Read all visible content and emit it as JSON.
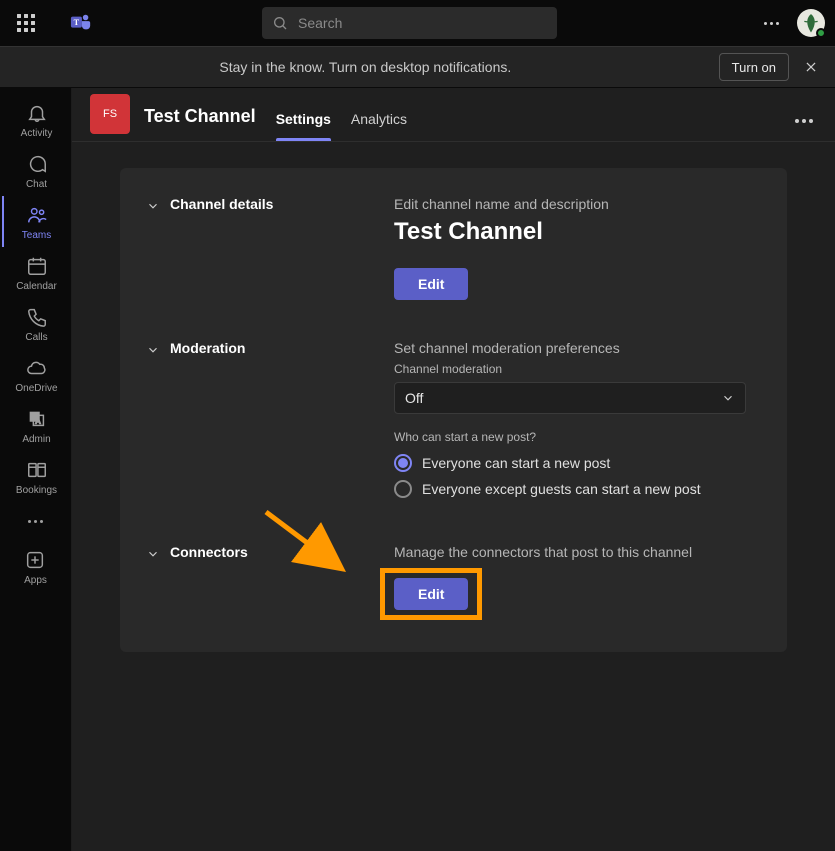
{
  "titlebar": {
    "search_placeholder": "Search"
  },
  "notif": {
    "text": "Stay in the know. Turn on desktop notifications.",
    "turn_on": "Turn on"
  },
  "rail": {
    "activity": "Activity",
    "chat": "Chat",
    "teams": "Teams",
    "calendar": "Calendar",
    "calls": "Calls",
    "onedrive": "OneDrive",
    "admin": "Admin",
    "bookings": "Bookings",
    "apps": "Apps"
  },
  "channel": {
    "badge": "FS",
    "name": "Test Channel",
    "tabs": {
      "settings": "Settings",
      "analytics": "Analytics"
    }
  },
  "sections": {
    "details": {
      "title": "Channel details",
      "desc": "Edit channel name and description",
      "name": "Test Channel",
      "edit": "Edit"
    },
    "moderation": {
      "title": "Moderation",
      "desc": "Set channel moderation preferences",
      "field_label": "Channel moderation",
      "select_value": "Off",
      "question": "Who can start a new post?",
      "opt1": "Everyone can start a new post",
      "opt2": "Everyone except guests can start a new post"
    },
    "connectors": {
      "title": "Connectors",
      "desc": "Manage the connectors that post to this channel",
      "edit": "Edit"
    }
  }
}
